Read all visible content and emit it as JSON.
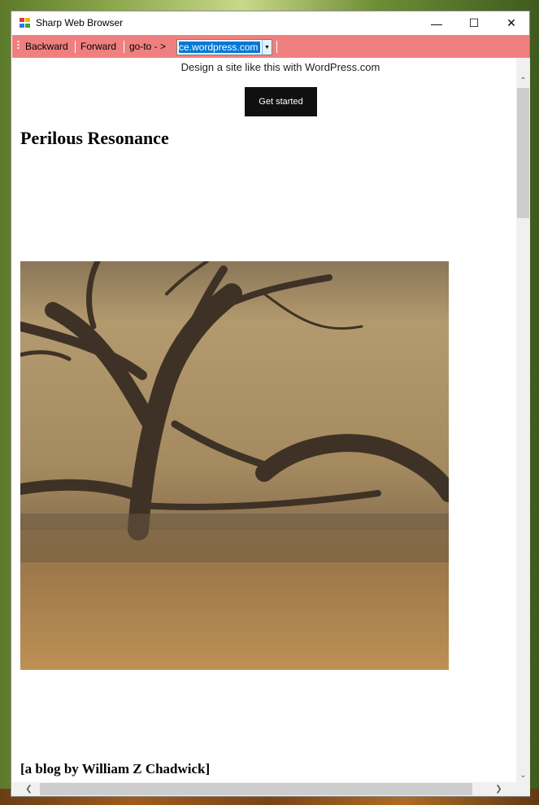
{
  "window": {
    "title": "Sharp Web Browser",
    "minimize_glyph": "—",
    "maximize_glyph": "☐",
    "close_glyph": "✕"
  },
  "toolbar": {
    "backward_label": "Backward",
    "forward_label": "Forward",
    "goto_label": "go-to - >",
    "url_value": "ce.wordpress.com",
    "background_color": "#f08080"
  },
  "page": {
    "promo_text": "Design a site like this with WordPress.com",
    "cta_label": "Get started",
    "blog_title": "Perilous Resonance",
    "byline": "[a blog by William Z Chadwick]"
  }
}
